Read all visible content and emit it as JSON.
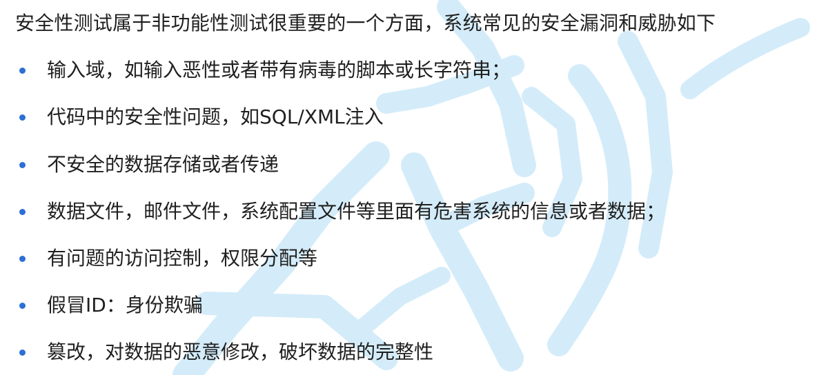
{
  "heading": "安全性测试属于非功能性测试很重要的一个方面，系统常见的安全漏洞和威胁如下",
  "items": [
    "输入域，如输入恶性或者带有病毒的脚本或长字符串；",
    "代码中的安全性问题，如SQL/XML注入",
    "不安全的数据存储或者传递",
    "数据文件，邮件文件，系统配置文件等里面有危害系统的信息或者数据；",
    "有问题的访问控制，权限分配等",
    "假冒ID：身份欺骗",
    "篡改，对数据的恶意修改，破坏数据的完整性"
  ],
  "colors": {
    "bullet": "#2c6fd6",
    "text": "#1f1f1f",
    "watermark": "#cfe9f8"
  },
  "watermark_icon": "brand-watermark-icon"
}
